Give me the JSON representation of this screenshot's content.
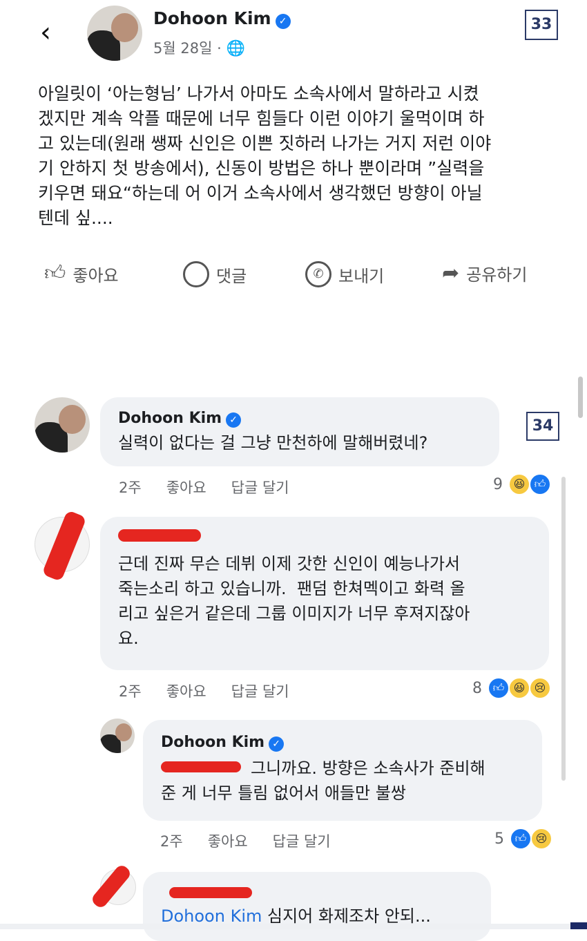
{
  "post": {
    "author": "Dohoon Kim",
    "date": "5월 28일 ·",
    "globe_icon": "globe-icon",
    "badge": "33",
    "text": "아일릿이 ‘아는형님’ 나가서 아마도 소속사에서 말하라고 시켰\n겠지만 계속 악플 때문에 너무 힘들다 이런 이야기 울먹이며 하\n고 있는데(원래 쌩짜 신인은 이쁜 짓하러 나가는 거지 저런 이야\n기 안하지 첫 방송에서), 신동이 방법은 하나 뿐이라며 ”실력을\n키우면 돼요“하는데 어 이거 소속사에서 생각했던 방향이 아닐\n텐데 싶...."
  },
  "actions": {
    "like": "좋아요",
    "comment": "댓글",
    "send": "보내기",
    "share": "공유하기"
  },
  "comments": [
    {
      "author": "Dohoon Kim",
      "badge": "34",
      "text": "실력이 없다는 걸 그냥 만천하에 말해버렸네?",
      "time": "2주",
      "like": "좋아요",
      "reply": "답글 달기",
      "count": "9"
    },
    {
      "author": "",
      "text": "근데 진짜 무슨 데뷔 이제 갓한 신인이 예능나가서\n죽는소리 하고 있습니까.  팬덤 한쳐멕이고 화력 올\n리고 싶은거 같은데 그룹 이미지가 너무 후져지잖아\n요.",
      "time": "2주",
      "like": "좋아요",
      "reply": "답글 달기",
      "count": "8"
    },
    {
      "author": "Dohoon Kim",
      "text": "그니까요. 방향은 소속사가 준비해\n준 게 너무 틀림 없어서 애들만 불쌍",
      "time": "2주",
      "like": "좋아요",
      "reply": "답글 달기",
      "count": "5"
    },
    {
      "author": "",
      "mention": "Dohoon Kim",
      "text": "심지어 화제조차 안되..."
    }
  ],
  "colors": {
    "accent": "#1877f2",
    "bubble": "#f0f2f5",
    "redaction": "#e52620"
  }
}
